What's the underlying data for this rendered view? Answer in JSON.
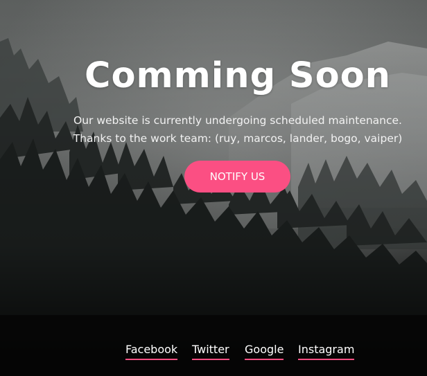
{
  "hero": {
    "title": "Comming Soon",
    "line1": "Our website is currently undergoing scheduled maintenance.",
    "line2": "Thanks to the work team: (ruy, marcos, lander, bogo, vaiper)",
    "notify_label": "NOTIFY US"
  },
  "social": {
    "facebook": "Facebook",
    "twitter": "Twitter",
    "google": "Google",
    "instagram": "Instagram"
  },
  "colors": {
    "accent": "#fb4f83",
    "text": "#ffffff"
  }
}
